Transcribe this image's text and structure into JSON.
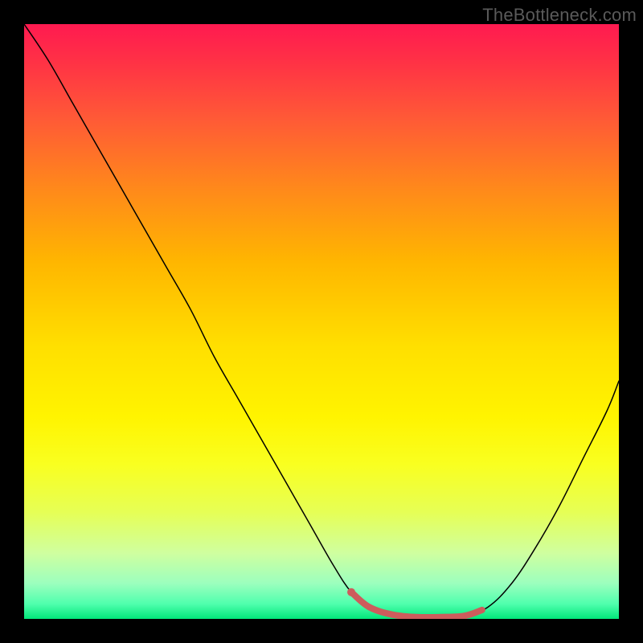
{
  "watermark": "TheBottleneck.com",
  "chart_data": {
    "type": "line",
    "title": "",
    "xlabel": "",
    "ylabel": "",
    "xlim": [
      0,
      100
    ],
    "ylim": [
      0,
      100
    ],
    "background_gradient": {
      "direction": "vertical",
      "stops": [
        {
          "pos": 0,
          "color": "#ff1a50"
        },
        {
          "pos": 0.06,
          "color": "#ff3046"
        },
        {
          "pos": 0.16,
          "color": "#ff5a36"
        },
        {
          "pos": 0.28,
          "color": "#ff8a1a"
        },
        {
          "pos": 0.4,
          "color": "#ffb600"
        },
        {
          "pos": 0.54,
          "color": "#ffdf00"
        },
        {
          "pos": 0.66,
          "color": "#fff400"
        },
        {
          "pos": 0.74,
          "color": "#f9ff20"
        },
        {
          "pos": 0.82,
          "color": "#e6ff55"
        },
        {
          "pos": 0.89,
          "color": "#cfffa0"
        },
        {
          "pos": 0.94,
          "color": "#9cffbe"
        },
        {
          "pos": 0.975,
          "color": "#4fffad"
        },
        {
          "pos": 1.0,
          "color": "#02e77a"
        }
      ]
    },
    "series": [
      {
        "name": "bottleneck-curve",
        "color": "#000000",
        "stroke_width": 1.5,
        "x": [
          0,
          4,
          8,
          12,
          16,
          20,
          24,
          28,
          32,
          36,
          40,
          44,
          48,
          52,
          55,
          58,
          62,
          66,
          70,
          74,
          78,
          82,
          86,
          90,
          94,
          98,
          100
        ],
        "y": [
          100,
          94,
          87,
          80,
          73,
          66,
          59,
          52,
          44,
          37,
          30,
          23,
          16,
          9,
          4.5,
          2.0,
          0.7,
          0.3,
          0.3,
          0.5,
          2.0,
          6,
          12,
          19,
          27,
          35,
          40
        ]
      },
      {
        "name": "optimal-zone",
        "color": "#cd5c5c",
        "stroke_width": 8,
        "x": [
          55,
          58,
          62,
          66,
          70,
          74,
          77
        ],
        "y": [
          4.5,
          2.0,
          0.7,
          0.3,
          0.3,
          0.5,
          1.5
        ]
      }
    ],
    "marker": {
      "name": "optimal-point",
      "color": "#cd5c5c",
      "radius": 5,
      "x": 55,
      "y": 4.5
    }
  }
}
